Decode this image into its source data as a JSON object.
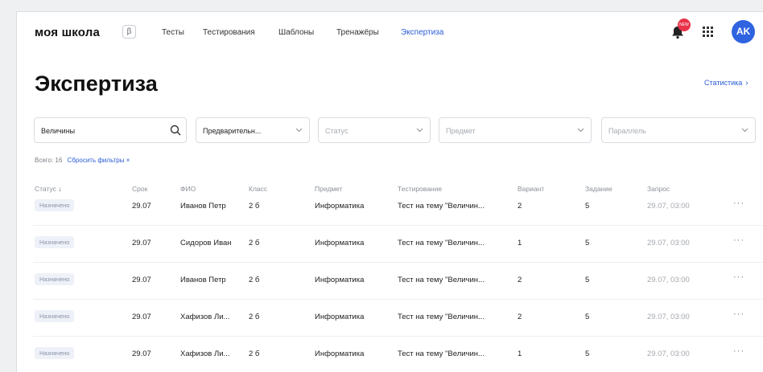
{
  "header": {
    "logo": "моя школа",
    "beta": "β",
    "nav": [
      "Тесты",
      "Тестирования",
      "Шаблоны",
      "Тренажёры",
      "Экспертиза"
    ],
    "active_nav": "Экспертиза",
    "notification_badge": "NEW",
    "avatar": "AK",
    "colors": {
      "accent": "#2a5bd7",
      "avatar_bg": "#2f63e0",
      "badge": "#e8334a"
    }
  },
  "page": {
    "title": "Экспертиза",
    "stats_link": "Статистика",
    "stats_chevron": "›"
  },
  "filters": {
    "search_value": "Величины",
    "stage_value": "Предварительн...",
    "status_placeholder": "Статус",
    "subject_placeholder": "Предмет",
    "parallel_placeholder": "Параллель",
    "total": "Всего: 16",
    "reset": "Сбросить фильтры ×"
  },
  "table": {
    "columns": [
      "Статус",
      "Срок",
      "ФИО",
      "Класс",
      "Предмет",
      "Тестирование",
      "Вариант",
      "Задание",
      "Запрос"
    ],
    "sort_indicator": "↓",
    "rows": [
      {
        "status": "Назначено",
        "deadline": "29.07",
        "name": "Иванов Петр",
        "class": "2 б",
        "subject": "Информатика",
        "test": "Тест на тему \"Величин...",
        "variant": "2",
        "task": "5",
        "request": "29.07, 03:00"
      },
      {
        "status": "Назначено",
        "deadline": "29.07",
        "name": "Сидоров Иван",
        "class": "2 б",
        "subject": "Информатика",
        "test": "Тест на тему \"Величин...",
        "variant": "1",
        "task": "5",
        "request": "29.07, 03:00"
      },
      {
        "status": "Назначено",
        "deadline": "29.07",
        "name": "Иванов Петр",
        "class": "2 б",
        "subject": "Информатика",
        "test": "Тест на тему \"Величин...",
        "variant": "2",
        "task": "5",
        "request": "29.07, 03:00"
      },
      {
        "status": "Назначено",
        "deadline": "29.07",
        "name": "Хафизов Ли...",
        "class": "2 б",
        "subject": "Информатика",
        "test": "Тест на тему \"Величин...",
        "variant": "2",
        "task": "5",
        "request": "29.07, 03:00"
      },
      {
        "status": "Назначено",
        "deadline": "29.07",
        "name": "Хафизов Ли...",
        "class": "2 б",
        "subject": "Информатика",
        "test": "Тест на тему \"Величин...",
        "variant": "1",
        "task": "5",
        "request": "29.07, 03:00"
      }
    ],
    "more": "···"
  },
  "icons": [
    "bell-icon",
    "apps-grid-icon",
    "search-icon",
    "chevron-down-icon",
    "more-icon"
  ]
}
